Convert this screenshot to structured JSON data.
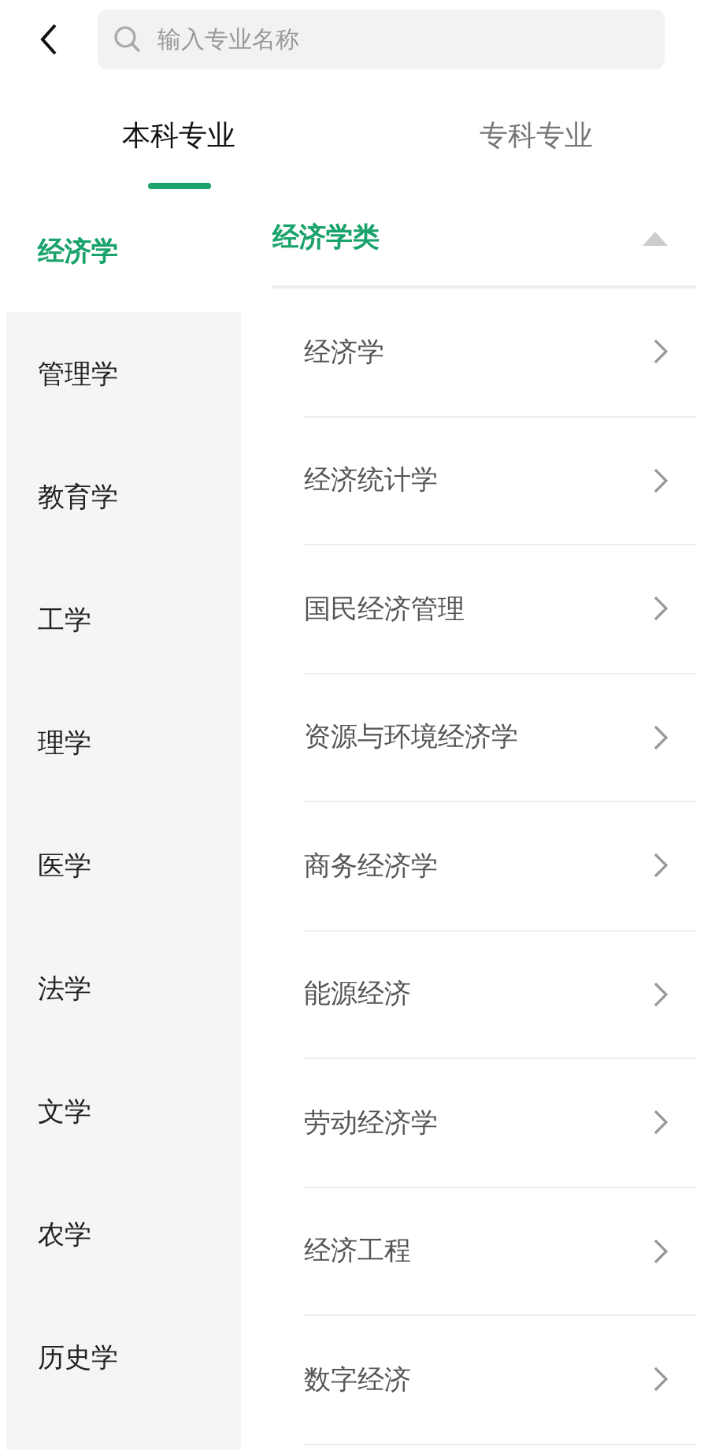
{
  "search": {
    "placeholder": "输入专业名称"
  },
  "tabs": [
    {
      "label": "本科专业",
      "selected": true
    },
    {
      "label": "专科专业",
      "selected": false
    }
  ],
  "sidebar": {
    "items": [
      {
        "label": "经济学",
        "selected": true
      },
      {
        "label": "管理学",
        "selected": false
      },
      {
        "label": "教育学",
        "selected": false
      },
      {
        "label": "工学",
        "selected": false
      },
      {
        "label": "理学",
        "selected": false
      },
      {
        "label": "医学",
        "selected": false
      },
      {
        "label": "法学",
        "selected": false
      },
      {
        "label": "文学",
        "selected": false
      },
      {
        "label": "农学",
        "selected": false
      },
      {
        "label": "历史学",
        "selected": false
      }
    ]
  },
  "category": {
    "title": "经济学类",
    "expanded": true,
    "items": [
      {
        "label": "经济学"
      },
      {
        "label": "经济统计学"
      },
      {
        "label": "国民经济管理"
      },
      {
        "label": "资源与环境经济学"
      },
      {
        "label": "商务经济学"
      },
      {
        "label": "能源经济"
      },
      {
        "label": "劳动经济学"
      },
      {
        "label": "经济工程"
      },
      {
        "label": "数字经济"
      }
    ]
  }
}
